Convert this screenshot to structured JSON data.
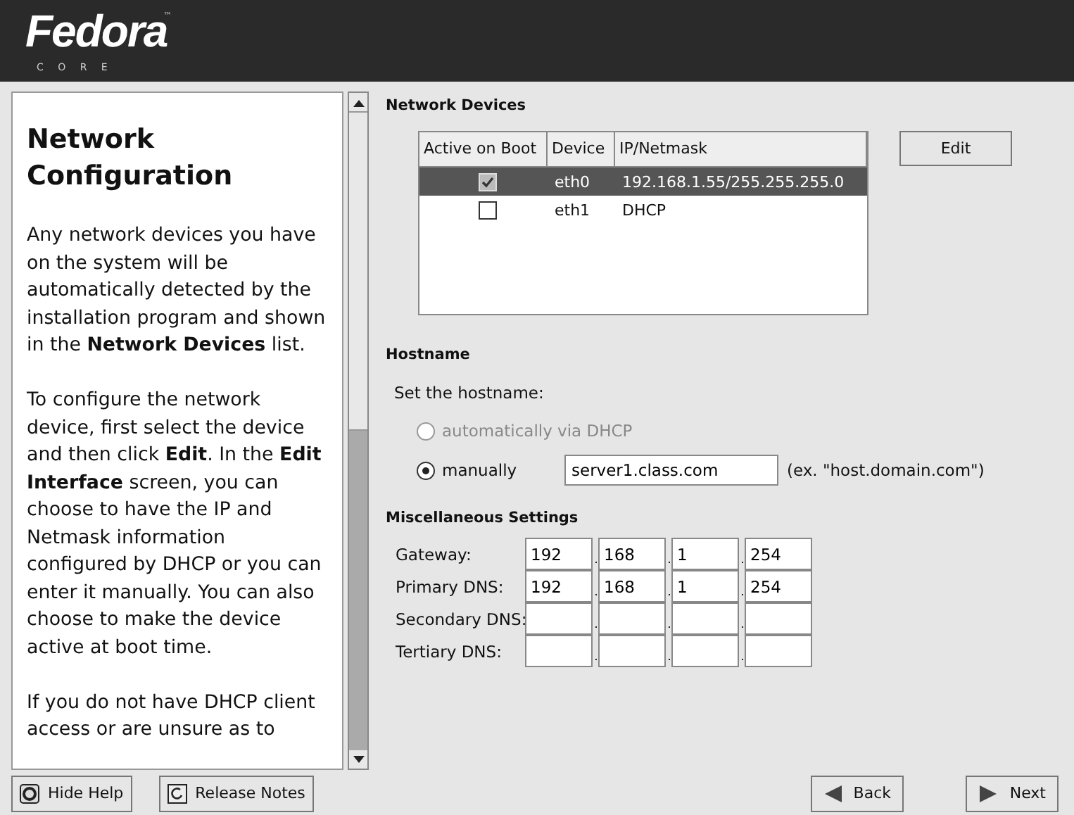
{
  "header": {
    "logo": "Fedora",
    "trademark": "™",
    "subtitle": "C O R E"
  },
  "help": {
    "title": "Network Configuration",
    "paragraphs": [
      "Any network devices you have on the system will be automatically detected by the installation program and shown in the **Network Devices** list.",
      "To configure the network device, first select the device and then click **Edit**. In the **Edit Interface** screen, you can choose to have the IP and Netmask information configured by DHCP or you can enter it manually. You can also choose to make the device active at boot time.",
      "If you do not have DHCP client access or are unsure as to"
    ]
  },
  "network_devices": {
    "heading": "Network Devices",
    "columns": [
      "Active on Boot",
      "Device",
      "IP/Netmask"
    ],
    "rows": [
      {
        "active": true,
        "device": "eth0",
        "ip": "192.168.1.55/255.255.255.0",
        "selected": true
      },
      {
        "active": false,
        "device": "eth1",
        "ip": "DHCP",
        "selected": false
      }
    ],
    "edit_button": "Edit"
  },
  "hostname": {
    "heading": "Hostname",
    "prompt": "Set the hostname:",
    "options": [
      {
        "label": "automatically via DHCP",
        "selected": false,
        "disabled": true
      },
      {
        "label": "manually",
        "selected": true,
        "disabled": false
      }
    ],
    "value": "server1.class.com",
    "example": "(ex. \"host.domain.com\")"
  },
  "misc": {
    "heading": "Miscellaneous Settings",
    "rows": [
      {
        "label": "Gateway:",
        "octets": [
          "192",
          "168",
          "1",
          "254"
        ]
      },
      {
        "label": "Primary DNS:",
        "octets": [
          "192",
          "168",
          "1",
          "254"
        ]
      },
      {
        "label": "Secondary DNS:"
      },
      {
        "label": "Tertiary DNS:"
      }
    ]
  },
  "buttons": {
    "hide_help": "Hide Help",
    "release_notes": "Release Notes",
    "back": "Back",
    "next": "Next"
  }
}
